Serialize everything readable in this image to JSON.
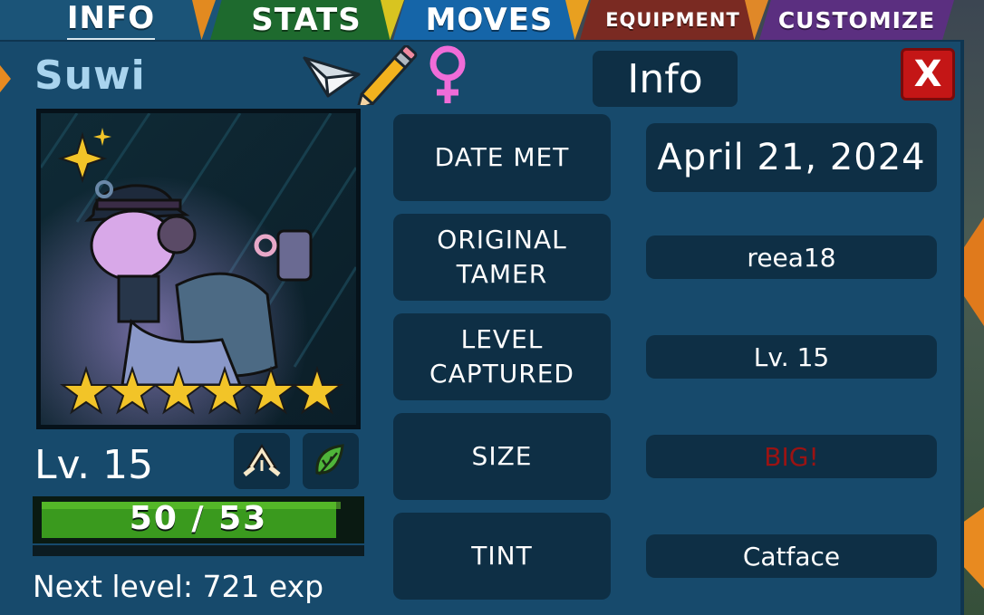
{
  "tabs": {
    "info": "INFO",
    "stats": "STATS",
    "moves": "MOVES",
    "equipment": "EQUIPMENT",
    "customize": "CUSTOMIZE",
    "active": "info"
  },
  "header": {
    "name": "Suwi",
    "title": "Info",
    "close_label": "X",
    "icons": [
      "paper-plane-icon",
      "pencil-icon",
      "female-symbol-icon"
    ]
  },
  "creature": {
    "level_label": "Lv. 15",
    "stars": 6,
    "type_icons": [
      "light-type-icon",
      "leaf-type-icon"
    ],
    "hp_text": "50 / 53",
    "hp_fraction": 0.94,
    "next_level": "Next level: 721 exp"
  },
  "info_rows": [
    {
      "label": "DATE MET",
      "value": "April 21, 2024"
    },
    {
      "label": "ORIGINAL TAMER",
      "value": "reea18"
    },
    {
      "label": "LEVEL CAPTURED",
      "value": "Lv. 15"
    },
    {
      "label": "SIZE",
      "value": "BIG!"
    },
    {
      "label": "TINT",
      "value": "Catface"
    }
  ],
  "colors": {
    "panel": "#174a6c",
    "box": "#0e2f45",
    "name": "#a9d4ee",
    "size_value": "#9a1313",
    "hp_green": "#3a9a1e",
    "star": "#f2c428"
  }
}
